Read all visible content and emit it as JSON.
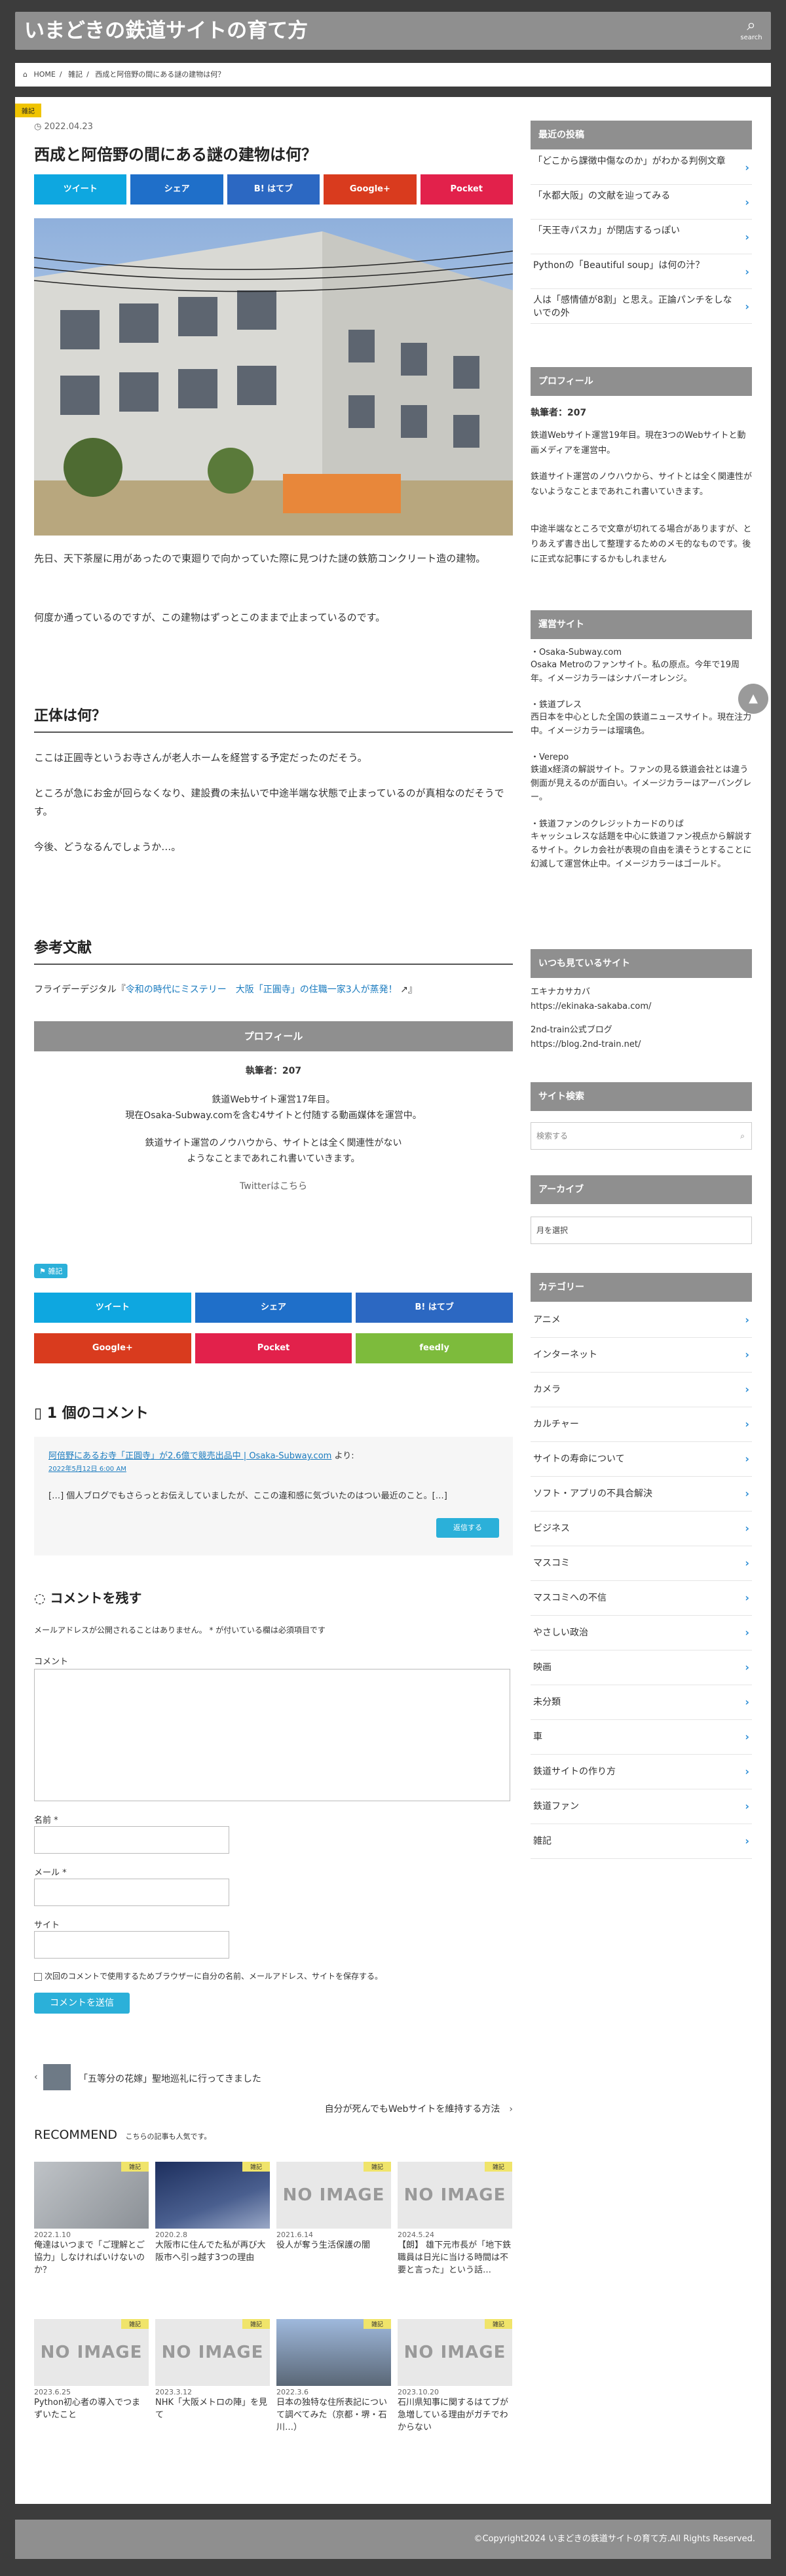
{
  "header": {
    "site_title": "いまどきの鉄道サイトの育て方",
    "search_label": "search",
    "search_icon": "search-icon"
  },
  "breadcrumb": [
    "HOME",
    "雑記",
    "西成と阿倍野の間にある謎の建物は何？"
  ],
  "article": {
    "category_flag": "雑記",
    "date": "2022.04.23",
    "title": "西成と阿倍野の間にある謎の建物は何？",
    "share_top": [
      {
        "label": "ツイート",
        "color": "#0ea7e0"
      },
      {
        "label": "シェア",
        "color": "#1f6fc9"
      },
      {
        "label": "B! はてブ",
        "color": "#2c68c2"
      },
      {
        "label": "Google+",
        "color": "#d93b1e"
      },
      {
        "label": "Pocket",
        "color": "#e2214b"
      }
    ],
    "intro_1": "先日、天下茶屋に用があったので東廻りで向かっていた際に見つけた謎の鉄筋コンクリート造の建物。",
    "intro_2": "何度か通っているのですが、この建物はずっとこのままで止まっているのです。",
    "h2_1": "正体は何？",
    "body_1": "ここは正圓寺というお寺さんが老人ホームを経営する予定だったのだそう。",
    "body_2": "ところが急にお金が回らなくなり、建設費の未払いで中途半端な状態で止まっているのが真相なのだそうです。",
    "body_3": "今後、どうなるんでしょうか…。",
    "h2_2": "参考文献",
    "ref_prefix": "フライデーデジタル『",
    "ref_link": "令和の時代にミステリー　大阪「正圓寺」の住職一家3人が蒸発！",
    "ref_suffix": "』",
    "tag": "雑記",
    "share_bottom": [
      {
        "label": "ツイート",
        "color": "#0ea7e0"
      },
      {
        "label": "シェア",
        "color": "#1f6fc9"
      },
      {
        "label": "B! はてブ",
        "color": "#2c68c2"
      },
      {
        "label": "Google+",
        "color": "#d93b1e"
      },
      {
        "label": "Pocket",
        "color": "#e2214b"
      },
      {
        "label": "feedly",
        "color": "#7dbb3c"
      }
    ]
  },
  "profile_box": {
    "heading": "プロフィール",
    "name": "執筆者：207",
    "line1": "鉄道Webサイト運営17年目。",
    "line2": "現在Osaka-Subway.comを含む4サイトと付随する動画媒体を運営中。",
    "line3": "鉄道サイト運営のノウハウから、サイトとは全く関連性がない",
    "line4": "ようなことまであれこれ書いていきます。",
    "twitter": "Twitterはこちら"
  },
  "comments": {
    "heading": "1 個のコメント",
    "item": {
      "author": "阿倍野にあるお寺「正圓寺」が2.6億で競売出品中 | Osaka-Subway.com",
      "author_suffix": "より:",
      "date": "2022年5月12日 6:00 AM",
      "text": "[…] 個人ブログでもさらっとお伝えしていましたが、ここの違和感に気づいたのはつい最近のこと。[…]",
      "reply": "返信する"
    }
  },
  "reply_form": {
    "heading": "コメントを残す",
    "note": "メールアドレスが公開されることはありません。 * が付いている欄は必須項目です",
    "comment_label": "コメント",
    "name_label": "名前 *",
    "email_label": "メール *",
    "site_label": "サイト",
    "save_label": "次回のコメントで使用するためブラウザーに自分の名前、メールアドレス、サイトを保存する。",
    "submit": "コメントを送信"
  },
  "post_nav": {
    "prev": "「五等分の花嫁」聖地巡礼に行ってきました",
    "next": "自分が死んでもWebサイトを維持する方法"
  },
  "recommend": {
    "heading": "RECOMMEND",
    "sub": "こちらの記事も人気です。",
    "items": [
      {
        "date": "2022.1.10",
        "title": "俺達はいつまで「ご理解とご協力」しなければいけないのか？",
        "flag": "雑記",
        "img": "photo"
      },
      {
        "date": "2020.2.8",
        "title": "大阪市に住んでた私が再び大阪市へ引っ越す3つの理由",
        "flag": "雑記",
        "img": "photo"
      },
      {
        "date": "2021.6.14",
        "title": "役人が奪う生活保護の闇",
        "flag": "雑記",
        "img": "NO IMAGE"
      },
      {
        "date": "2024.5.24",
        "title": "【朗】 雄下元市長が「地下鉄職員は日光に当ける時間は不要と言った」という話…",
        "flag": "雑記",
        "img": "NO IMAGE"
      },
      {
        "date": "2023.6.25",
        "title": "Python初心者の導入でつまずいたこと",
        "flag": "雑記",
        "img": "NO IMAGE"
      },
      {
        "date": "2023.3.12",
        "title": "NHK「大阪メトロの陣」を見て",
        "flag": "雑記",
        "img": "NO IMAGE"
      },
      {
        "date": "2022.3.6",
        "title": "日本の独特な住所表記について調べてみた（京都・堺・石川…）",
        "flag": "雑記",
        "img": "photo"
      },
      {
        "date": "2023.10.20",
        "title": "石川県知事に関するはてブが急増している理由がガチでわからない",
        "flag": "雑記",
        "img": "NO IMAGE"
      }
    ],
    "noimage": "NO IMAGE"
  },
  "sidebar": {
    "recent_heading": "最近の投稿",
    "recent": [
      "「どこから課徴中傷なのか」がわかる判例文章",
      "「水都大阪」の文献を辿ってみる",
      "「天王寺パスカ」が閉店するっぽい",
      "Pythonの「Beautiful soup」は何の汁？",
      "人は「感情値が8割」と思え。正論パンチをしないでの外"
    ],
    "profile_heading": "プロフィール",
    "profile_name": "執筆者：207",
    "profile_p1": "鉄道Webサイト運営19年目。現在3つのWebサイトと動画メディアを運営中。",
    "profile_p2": "鉄道サイト運営のノウハウから、サイトとは全く関連性がないようなことまであれこれ書いていきます。",
    "profile_p3": "中途半端なところで文章が切れてる場合がありますが、とりあえず書き出して整理するためのメモ的なものです。後に正式な記事にするかもしれません",
    "sites_heading": "運営サイト",
    "sites": [
      {
        "name": "・Osaka-Subway.com",
        "desc": "Osaka Metroのファンサイト。私の原点。今年で19周年。イメージカラーはシナバーオレンジ。"
      },
      {
        "name": "・鉄道プレス",
        "desc": "西日本を中心とした全国の鉄道ニュースサイト。現在注力中。イメージカラーは瑠璃色。"
      },
      {
        "name": "・Verepo",
        "desc": "鉄道x経済の解説サイト。ファンの見る鉄道会社とは違う側面が見えるのが面白い。イメージカラーはアーバングレー。"
      },
      {
        "name": "・鉄道ファンのクレジットカードのりば",
        "desc": "キャッシュレスな話題を中心に鉄道ファン視点から解説するサイト。クレカ会社が表現の自由を潰そうとすることに幻滅して運営休止中。イメージカラーはゴールド。"
      }
    ],
    "watch_heading": "いつも見ているサイト",
    "watch": [
      {
        "name": "エキナカサカバ",
        "url": "https://ekinaka-sakaba.com/"
      },
      {
        "name": "2nd-train公式ブログ",
        "url": "https://blog.2nd-train.net/"
      }
    ],
    "search_heading": "サイト検索",
    "search_placeholder": "検索する",
    "archive_heading": "アーカイブ",
    "archive_select": "月を選択",
    "cat_heading": "カテゴリー",
    "categories": [
      "アニメ",
      "インターネット",
      "カメラ",
      "カルチャー",
      "サイトの寿命について",
      "ソフト・アプリの不具合解決",
      "ビジネス",
      "マスコミ",
      "マスコミへの不信",
      "やさしい政治",
      "映画",
      "未分類",
      "車",
      "鉄道サイトの作り方",
      "鉄道ファン",
      "雑記"
    ]
  },
  "footer": {
    "copyright": "©Copyright2024 いまどきの鉄道サイトの育て方.All Rights Reserved."
  },
  "colors": {
    "header": "#8f8f8f",
    "accent": "#2bb0d9",
    "link": "#1a7bbf",
    "background": "#3c3c3c"
  }
}
